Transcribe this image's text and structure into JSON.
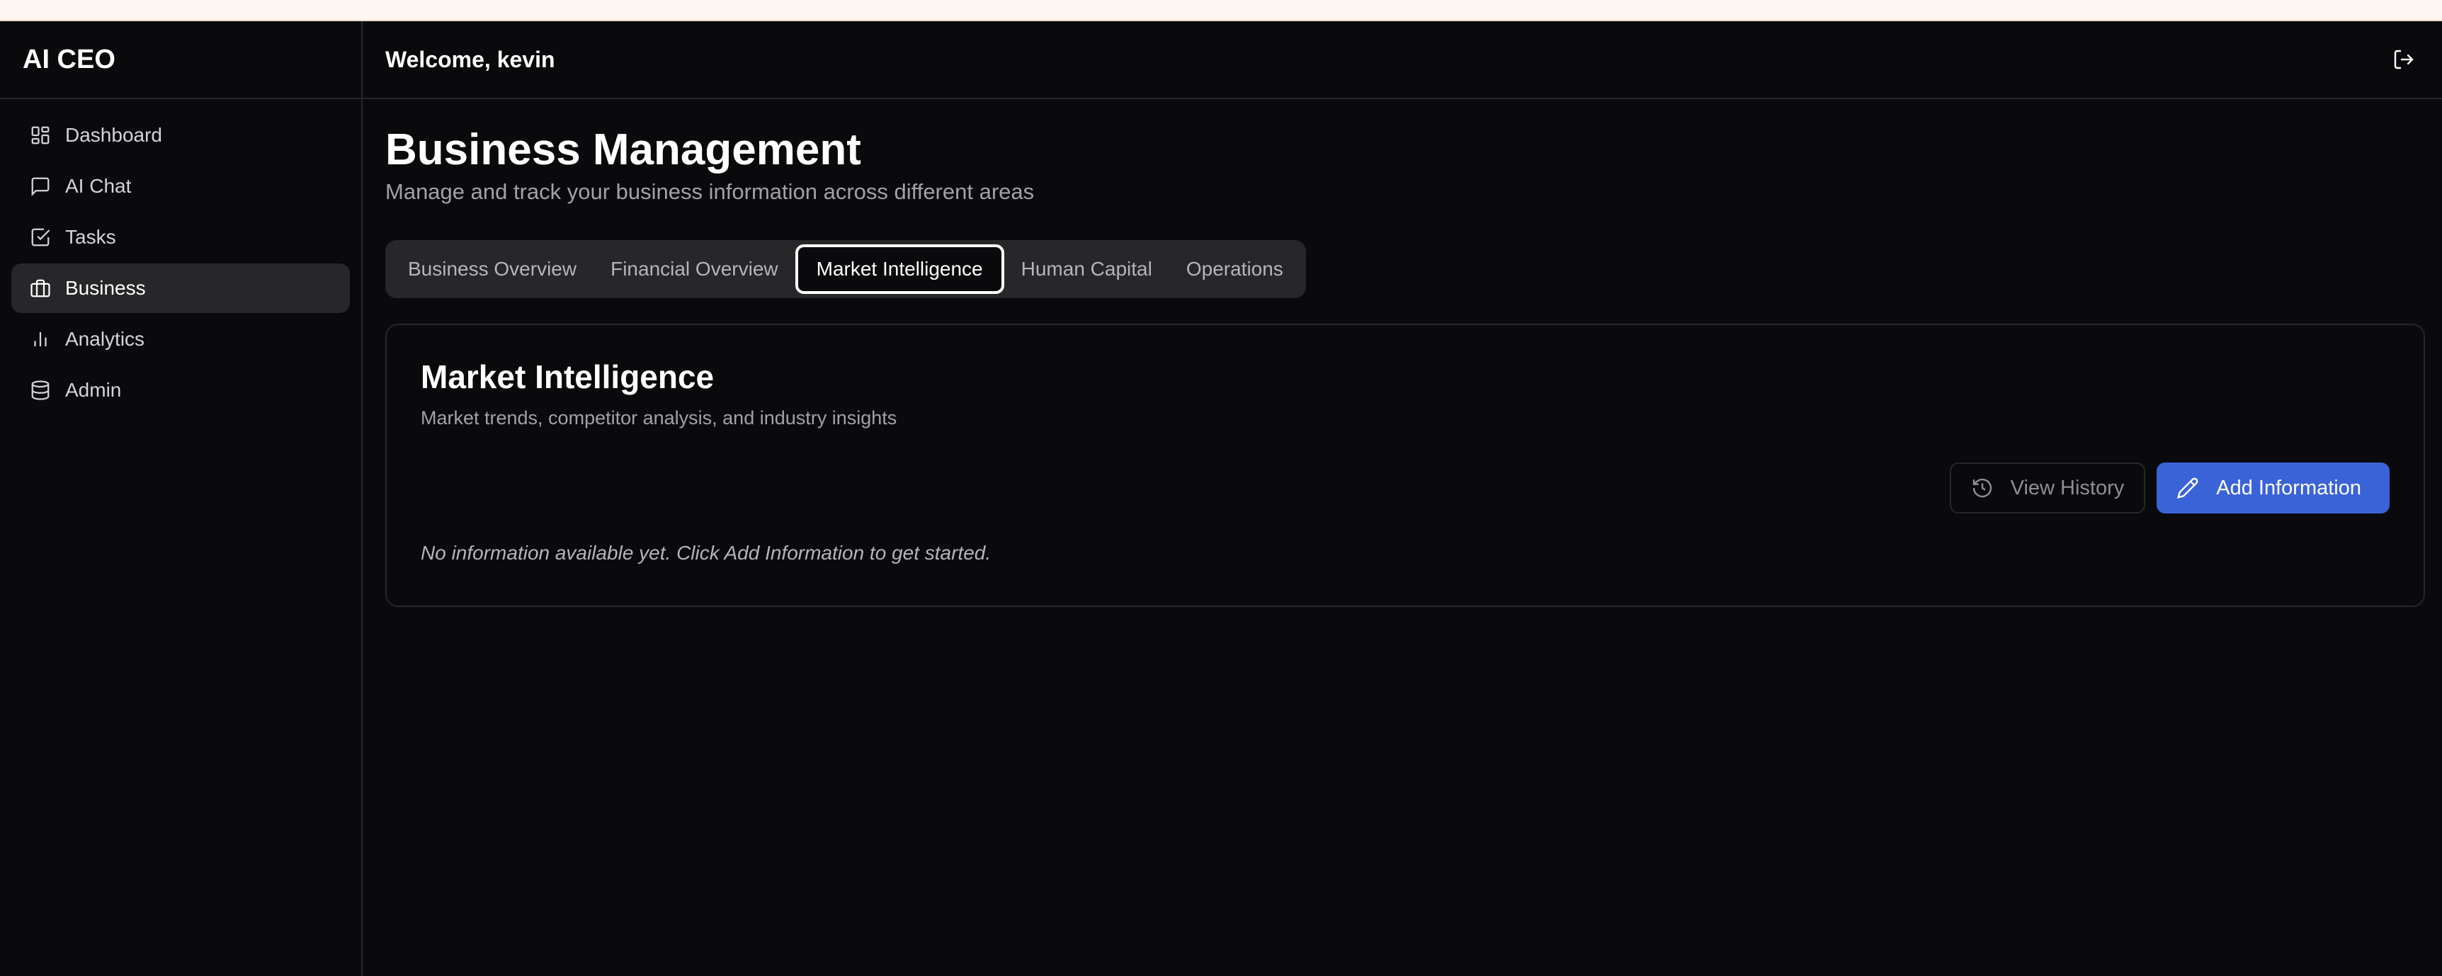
{
  "app": {
    "brand": "AI CEO"
  },
  "header": {
    "welcome": "Welcome, kevin",
    "logout_icon": "logout-icon"
  },
  "sidebar": {
    "items": [
      {
        "label": "Dashboard",
        "icon": "layout-grid-icon"
      },
      {
        "label": "AI Chat",
        "icon": "message-square-icon"
      },
      {
        "label": "Tasks",
        "icon": "check-square-icon"
      },
      {
        "label": "Business",
        "icon": "briefcase-icon",
        "active": true
      },
      {
        "label": "Analytics",
        "icon": "bar-chart-icon"
      },
      {
        "label": "Admin",
        "icon": "database-icon"
      }
    ]
  },
  "page": {
    "title": "Business Management",
    "subtitle": "Manage and track your business information across different areas"
  },
  "tabs": [
    {
      "label": "Business Overview"
    },
    {
      "label": "Financial Overview"
    },
    {
      "label": "Market Intelligence",
      "active": true
    },
    {
      "label": "Human Capital"
    },
    {
      "label": "Operations"
    }
  ],
  "card": {
    "title": "Market Intelligence",
    "description": "Market trends, competitor analysis, and industry insights",
    "view_history_label": "View History",
    "add_info_label": "Add Information",
    "empty_message": "No information available yet. Click Add Information to get started."
  },
  "colors": {
    "background": "#0a0a0c",
    "border": "#27272a",
    "accent": "#3b63d8"
  }
}
